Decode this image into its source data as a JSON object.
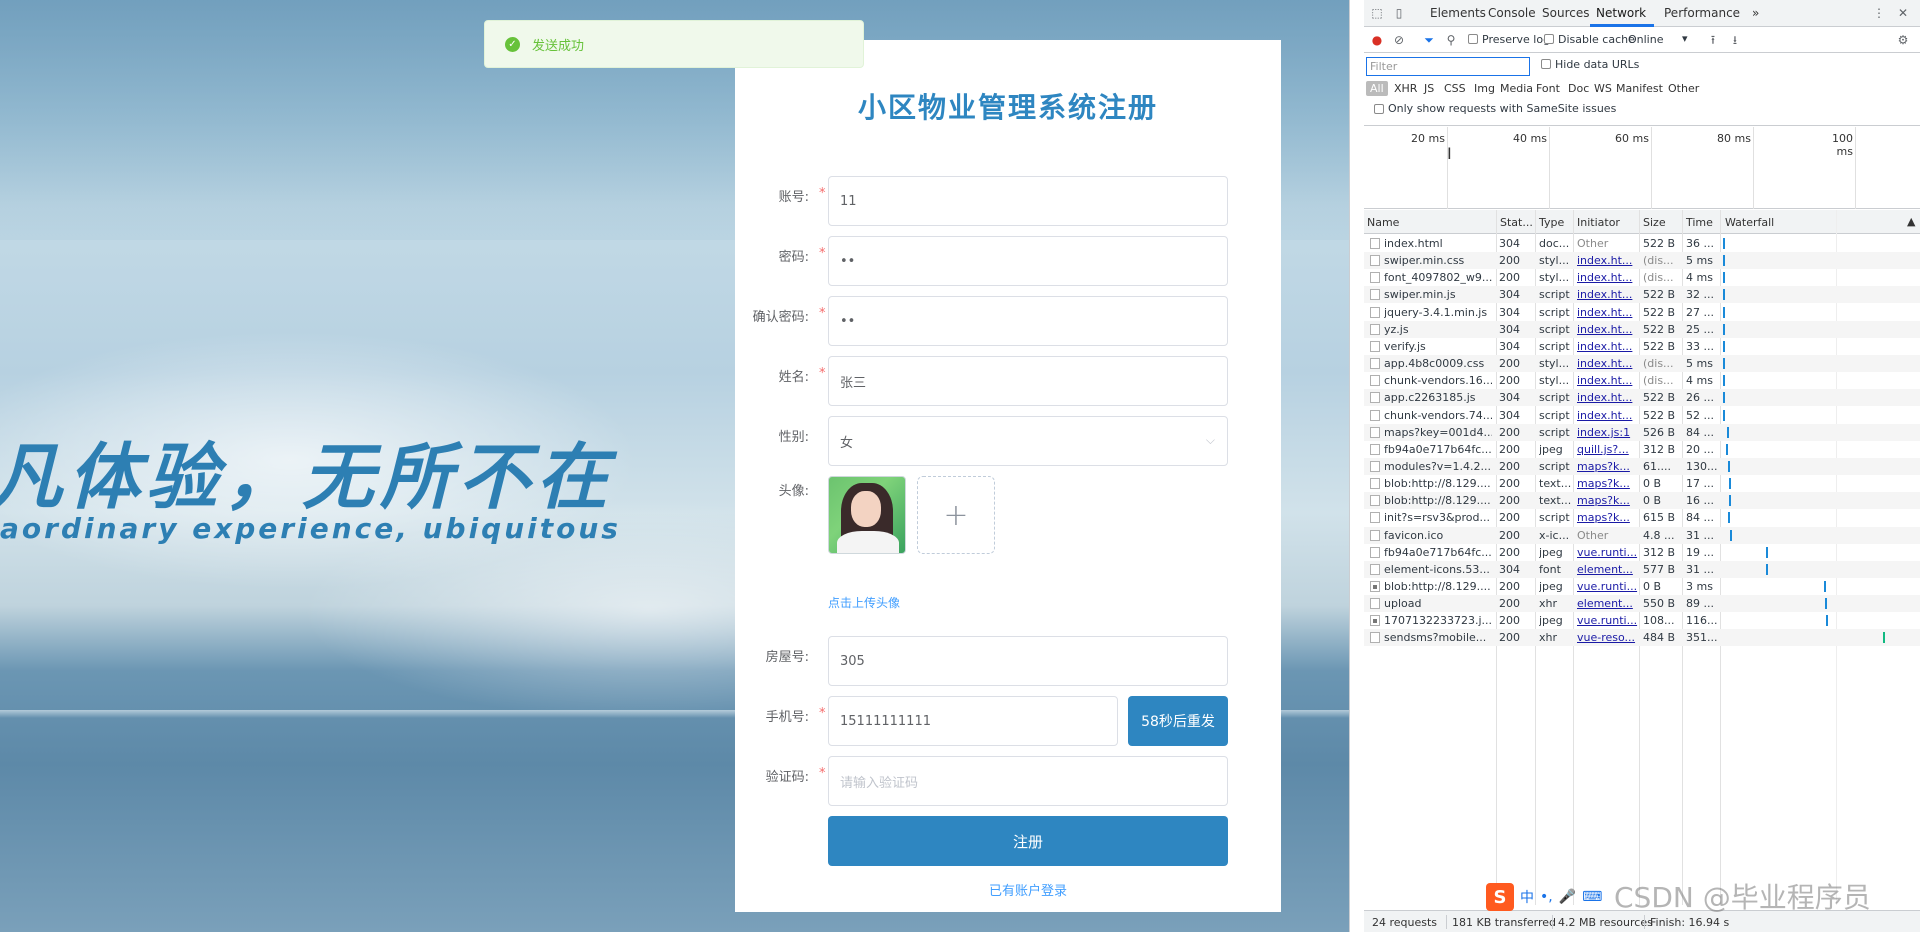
{
  "toast": {
    "message": "发送成功",
    "icon": "check-circle-icon"
  },
  "slogan": {
    "cn": "凡体验，无所不在",
    "en": "aordinary experience, ubiquitous"
  },
  "form": {
    "title": "小区物业管理系统注册",
    "account": {
      "label": "账号:",
      "value": "11"
    },
    "password": {
      "label": "密码:",
      "value": "••"
    },
    "confirm": {
      "label": "确认密码:",
      "value": "••"
    },
    "name": {
      "label": "姓名:",
      "value": "张三"
    },
    "gender": {
      "label": "性别:",
      "value": "女"
    },
    "avatar": {
      "label": "头像:",
      "hint": "点击上传头像",
      "add": "+"
    },
    "room": {
      "label": "房屋号:",
      "value": "305"
    },
    "phone": {
      "label": "手机号:",
      "value": "15111111111",
      "resend": "58秒后重发"
    },
    "code": {
      "label": "验证码:",
      "placeholder": "请输入验证码"
    },
    "submit": "注册",
    "login_link": "已有账户登录",
    "required_mark": "*"
  },
  "devtools": {
    "tabs": [
      "Elements",
      "Console",
      "Sources",
      "Network",
      "Performance"
    ],
    "active_tab": "Network",
    "more": "»",
    "toolbar": {
      "preserve_log": "Preserve log",
      "disable_cache": "Disable cache",
      "throttle": "Online"
    },
    "filter": {
      "placeholder": "Filter",
      "hide_data_urls": "Hide data URLs",
      "types": [
        "All",
        "XHR",
        "JS",
        "CSS",
        "Img",
        "Media",
        "Font",
        "Doc",
        "WS",
        "Manifest",
        "Other"
      ],
      "samesite": "Only show requests with SameSite issues"
    },
    "overview_ticks": [
      "20 ms",
      "40 ms",
      "60 ms",
      "80 ms",
      "100 ms"
    ],
    "columns": [
      "Name",
      "Stat...",
      "Type",
      "Initiator",
      "Size",
      "Time",
      "Waterfall"
    ],
    "rows": [
      {
        "name": "index.html",
        "status": "304",
        "type": "doc...",
        "initiator": "Other",
        "size": "522 B",
        "time": "36 ...",
        "icon": "doc"
      },
      {
        "name": "swiper.min.css",
        "status": "200",
        "type": "styl...",
        "initiator": "index.ht...",
        "size": "(dis...",
        "time": "5 ms",
        "icon": "doc"
      },
      {
        "name": "font_4097802_w9...",
        "status": "200",
        "type": "styl...",
        "initiator": "index.ht...",
        "size": "(dis...",
        "time": "4 ms",
        "icon": "doc"
      },
      {
        "name": "swiper.min.js",
        "status": "304",
        "type": "script",
        "initiator": "index.ht...",
        "size": "522 B",
        "time": "32 ...",
        "icon": "doc"
      },
      {
        "name": "jquery-3.4.1.min.js",
        "status": "304",
        "type": "script",
        "initiator": "index.ht...",
        "size": "522 B",
        "time": "27 ...",
        "icon": "doc"
      },
      {
        "name": "yz.js",
        "status": "304",
        "type": "script",
        "initiator": "index.ht...",
        "size": "522 B",
        "time": "25 ...",
        "icon": "doc"
      },
      {
        "name": "verify.js",
        "status": "304",
        "type": "script",
        "initiator": "index.ht...",
        "size": "522 B",
        "time": "33 ...",
        "icon": "doc"
      },
      {
        "name": "app.4b8c0009.css",
        "status": "200",
        "type": "styl...",
        "initiator": "index.ht...",
        "size": "(dis...",
        "time": "5 ms",
        "icon": "doc"
      },
      {
        "name": "chunk-vendors.16...",
        "status": "200",
        "type": "styl...",
        "initiator": "index.ht...",
        "size": "(dis...",
        "time": "4 ms",
        "icon": "doc"
      },
      {
        "name": "app.c2263185.js",
        "status": "304",
        "type": "script",
        "initiator": "index.ht...",
        "size": "522 B",
        "time": "26 ...",
        "icon": "doc"
      },
      {
        "name": "chunk-vendors.74...",
        "status": "304",
        "type": "script",
        "initiator": "index.ht...",
        "size": "522 B",
        "time": "52 ...",
        "icon": "doc"
      },
      {
        "name": "maps?key=001d4...",
        "status": "200",
        "type": "script",
        "initiator": "index.js:1",
        "size": "526 B",
        "time": "84 ...",
        "icon": "doc"
      },
      {
        "name": "fb94a0e717b64fc...",
        "status": "200",
        "type": "jpeg",
        "initiator": "quill.js?...",
        "size": "312 B",
        "time": "20 ...",
        "icon": "lines"
      },
      {
        "name": "modules?v=1.4.2...",
        "status": "200",
        "type": "script",
        "initiator": "maps?k...",
        "size": "61....",
        "time": "130...",
        "icon": "doc"
      },
      {
        "name": "blob:http://8.129....",
        "status": "200",
        "type": "text...",
        "initiator": "maps?k...",
        "size": "0 B",
        "time": "17 ...",
        "icon": "doc"
      },
      {
        "name": "blob:http://8.129....",
        "status": "200",
        "type": "text...",
        "initiator": "maps?k...",
        "size": "0 B",
        "time": "16 ...",
        "icon": "doc"
      },
      {
        "name": "init?s=rsv3&prod...",
        "status": "200",
        "type": "script",
        "initiator": "maps?k...",
        "size": "615 B",
        "time": "84 ...",
        "icon": "doc"
      },
      {
        "name": "favicon.ico",
        "status": "200",
        "type": "x-ic...",
        "initiator": "Other",
        "size": "4.8 ...",
        "time": "31 ...",
        "icon": "doc"
      },
      {
        "name": "fb94a0e717b64fc...",
        "status": "200",
        "type": "jpeg",
        "initiator": "vue.runti...",
        "size": "312 B",
        "time": "19 ...",
        "icon": "lines"
      },
      {
        "name": "element-icons.53...",
        "status": "304",
        "type": "font",
        "initiator": "element...",
        "size": "577 B",
        "time": "31 ...",
        "icon": "doc"
      },
      {
        "name": "blob:http://8.129....",
        "status": "200",
        "type": "jpeg",
        "initiator": "vue.runti...",
        "size": "0 B",
        "time": "3 ms",
        "icon": "img"
      },
      {
        "name": "upload",
        "status": "200",
        "type": "xhr",
        "initiator": "element...",
        "size": "550 B",
        "time": "89 ...",
        "icon": "doc"
      },
      {
        "name": "1707132233723.j...",
        "status": "200",
        "type": "jpeg",
        "initiator": "vue.runti...",
        "size": "108...",
        "time": "116...",
        "icon": "img"
      },
      {
        "name": "sendsms?mobile...",
        "status": "200",
        "type": "xhr",
        "initiator": "vue-reso...",
        "size": "484 B",
        "time": "351...",
        "icon": "doc"
      }
    ],
    "status": {
      "requests": "24 requests",
      "transferred": "181 KB transferred",
      "resources": "4.2 MB resources",
      "finish": "Finish: 16.94 s"
    }
  },
  "ime": {
    "logo": "S",
    "mode": "中"
  },
  "watermark": "CSDN @毕业程序员"
}
